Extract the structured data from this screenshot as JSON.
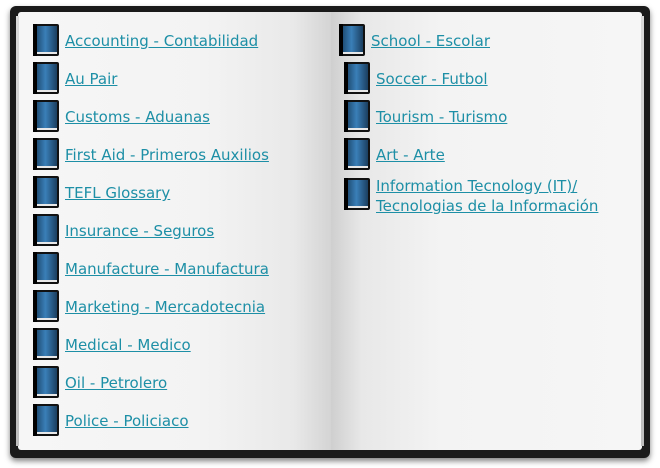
{
  "left_items": [
    {
      "label": "Accounting - Contabilidad"
    },
    {
      "label": "Au Pair"
    },
    {
      "label": "Customs - Aduanas"
    },
    {
      "label": "First Aid - Primeros Auxilios"
    },
    {
      "label": "TEFL Glossary"
    },
    {
      "label": "Insurance - Seguros"
    },
    {
      "label": "Manufacture - Manufactura"
    },
    {
      "label": "Marketing - Mercadotecnia"
    },
    {
      "label": "Medical - Medico"
    },
    {
      "label": "Oil - Petrolero"
    },
    {
      "label": "Police - Policiaco"
    }
  ],
  "right_items": [
    {
      "label": "School - Escolar"
    },
    {
      "label": "Soccer - Futbol"
    },
    {
      "label": "Tourism - Turismo"
    },
    {
      "label": "Art - Arte"
    },
    {
      "label_line1": "Information Tecnology (IT)/",
      "label_line2": "Tecnologias de la Información"
    }
  ],
  "colors": {
    "link": "#1d8fa6",
    "book_cover": "#1a1a1a",
    "icon_blue": "#2f6ea5"
  },
  "icons": {
    "item_icon": "book-icon"
  }
}
